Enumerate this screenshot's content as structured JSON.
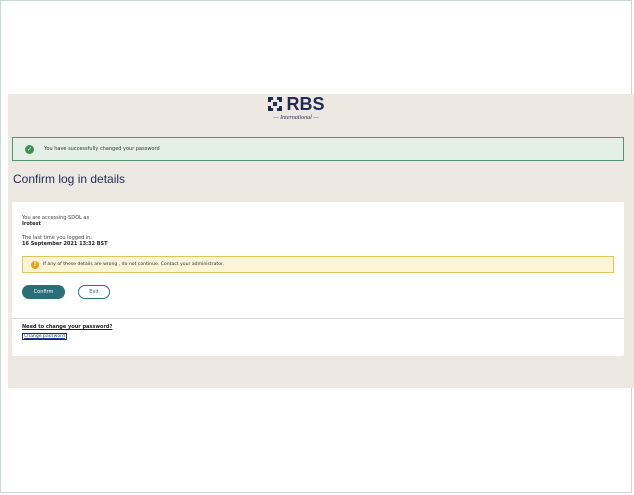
{
  "brand": {
    "name": "RBS",
    "tagline": "International"
  },
  "banner": {
    "message": "You have successfully changed your password"
  },
  "page": {
    "title": "Confirm log in details"
  },
  "details": {
    "accessing_label": "You are accessing SDOL as",
    "username": "Irotest",
    "last_login_label": "The last time you logged in:",
    "last_login_value": "16 September 2021 13:32 BST"
  },
  "warning": {
    "text": "If any of these details are wrong , do not continue. Contact your administrator."
  },
  "buttons": {
    "confirm": "Confirm",
    "exit": "Exit"
  },
  "password": {
    "heading": "Need to change your password?",
    "link": "Change password"
  },
  "colors": {
    "brand_navy": "#1f2a56",
    "primary_teal": "#2a6f78",
    "success_green": "#3f8f5d",
    "warning_amber": "#e3a417",
    "page_background": "#ede9e2"
  }
}
